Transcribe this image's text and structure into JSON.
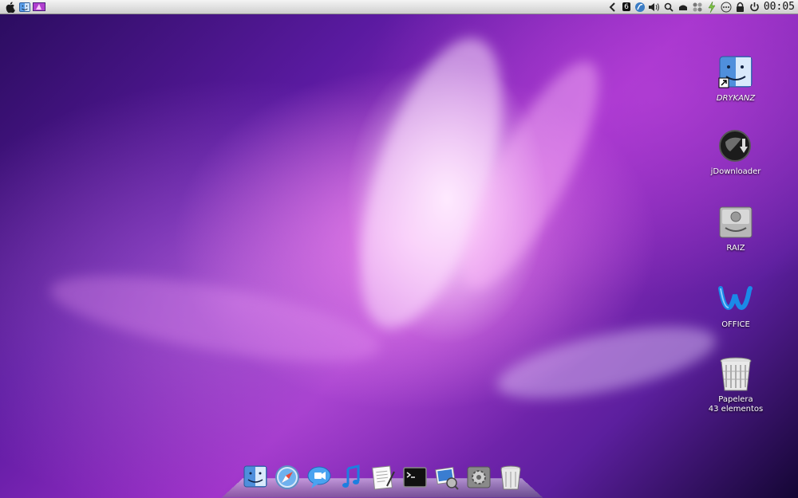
{
  "menubar": {
    "left_icons": [
      "apple-icon",
      "finder-icon",
      "wallpaper-icon"
    ],
    "right_icons": [
      "back-arrow-icon",
      "badge-6-icon",
      "spaces-icon",
      "volume-icon",
      "search-icon",
      "home-icon",
      "grid-icon",
      "bolt-icon",
      "more-icon",
      "lock-icon",
      "power-icon"
    ],
    "badge": "6",
    "clock": "00:05"
  },
  "desktop": {
    "icons": [
      {
        "label": "DRYKANZ",
        "icon": "finder-alias-icon"
      },
      {
        "label": "jDownloader",
        "icon": "jdownloader-icon"
      },
      {
        "label": "RAIZ",
        "icon": "hard-drive-icon"
      },
      {
        "label": "OFFICE",
        "icon": "office-icon"
      },
      {
        "label": "Papelera",
        "sublabel": "43 elementos",
        "icon": "trash-icon"
      }
    ]
  },
  "dock": {
    "items": [
      "finder",
      "safari",
      "ichat",
      "itunes",
      "textedit",
      "terminal",
      "preview",
      "system-preferences",
      "trash"
    ]
  },
  "colors": {
    "menubar": "#dcdcdc",
    "desktop_accent": "#c24fd8"
  }
}
